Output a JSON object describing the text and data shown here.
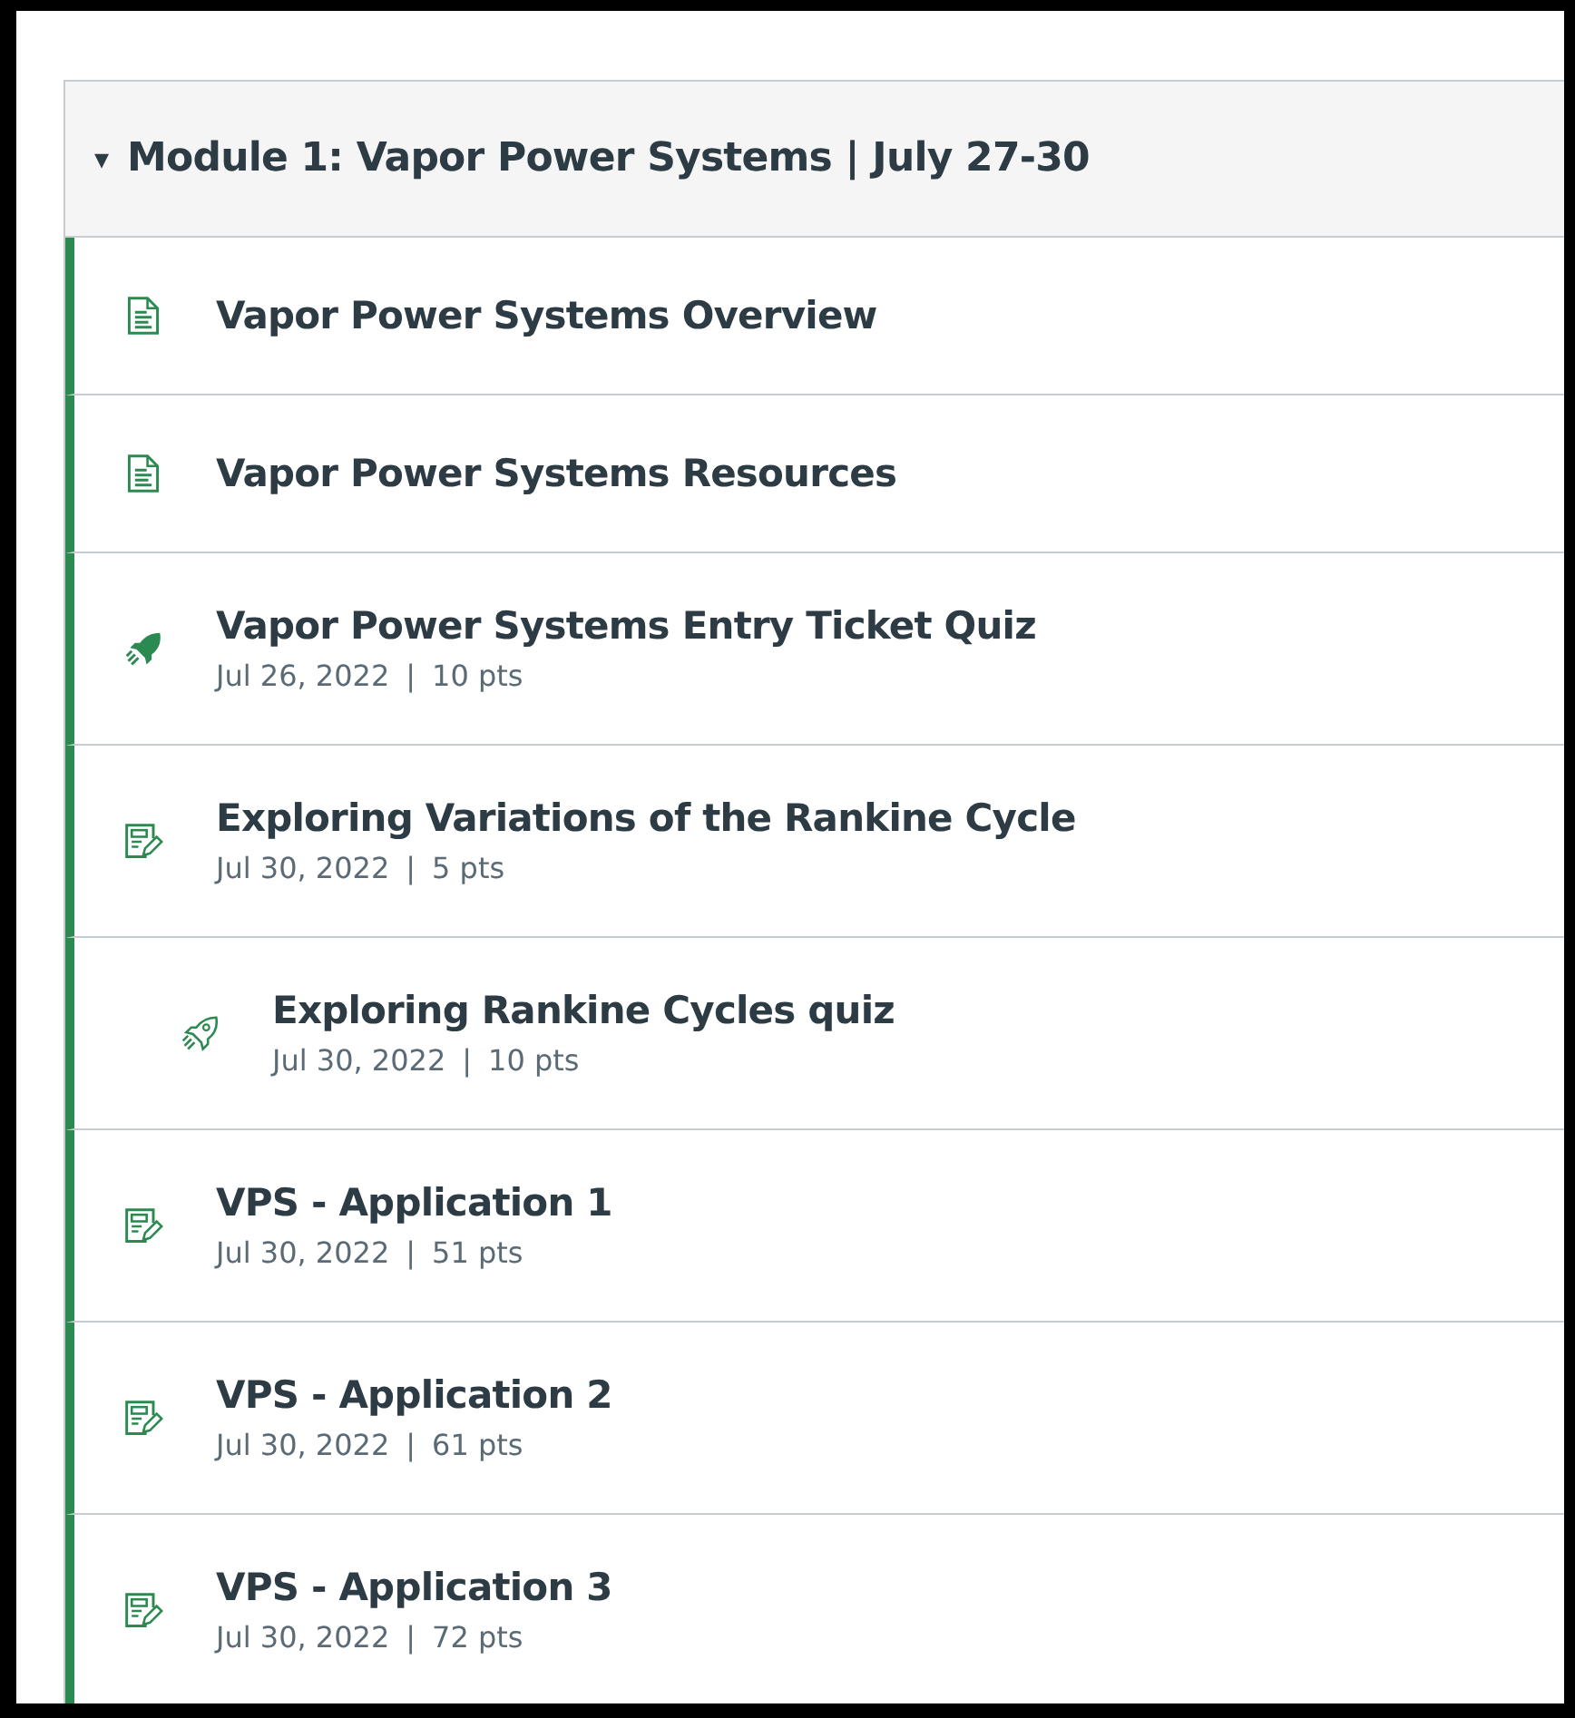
{
  "module": {
    "toggle": "▾",
    "title": "Module 1: Vapor Power Systems | July 27-30",
    "expanded": true,
    "items": [
      {
        "kind": "page",
        "title": "Vapor Power Systems Overview"
      },
      {
        "kind": "page",
        "title": "Vapor Power Systems Resources"
      },
      {
        "kind": "quiz",
        "title": "Vapor Power Systems Entry Ticket Quiz",
        "date": "Jul 26, 2022",
        "separator": "|",
        "points": "10 pts"
      },
      {
        "kind": "assignment",
        "title": "Exploring Variations of the Rankine Cycle",
        "date": "Jul 30, 2022",
        "separator": "|",
        "points": "5 pts",
        "children": [
          {
            "kind": "new-quiz",
            "title": "Exploring Rankine Cycles quiz",
            "date": "Jul 30, 2022",
            "separator": "|",
            "points": "10 pts"
          }
        ]
      },
      {
        "kind": "assignment",
        "title": "VPS - Application 1",
        "date": "Jul 30, 2022",
        "separator": "|",
        "points": "51 pts"
      },
      {
        "kind": "assignment",
        "title": "VPS - Application 2",
        "date": "Jul 30, 2022",
        "separator": "|",
        "points": "61 pts"
      },
      {
        "kind": "assignment",
        "title": "VPS - Application 3",
        "date": "Jul 30, 2022",
        "separator": "|",
        "points": "72 pts"
      }
    ]
  }
}
